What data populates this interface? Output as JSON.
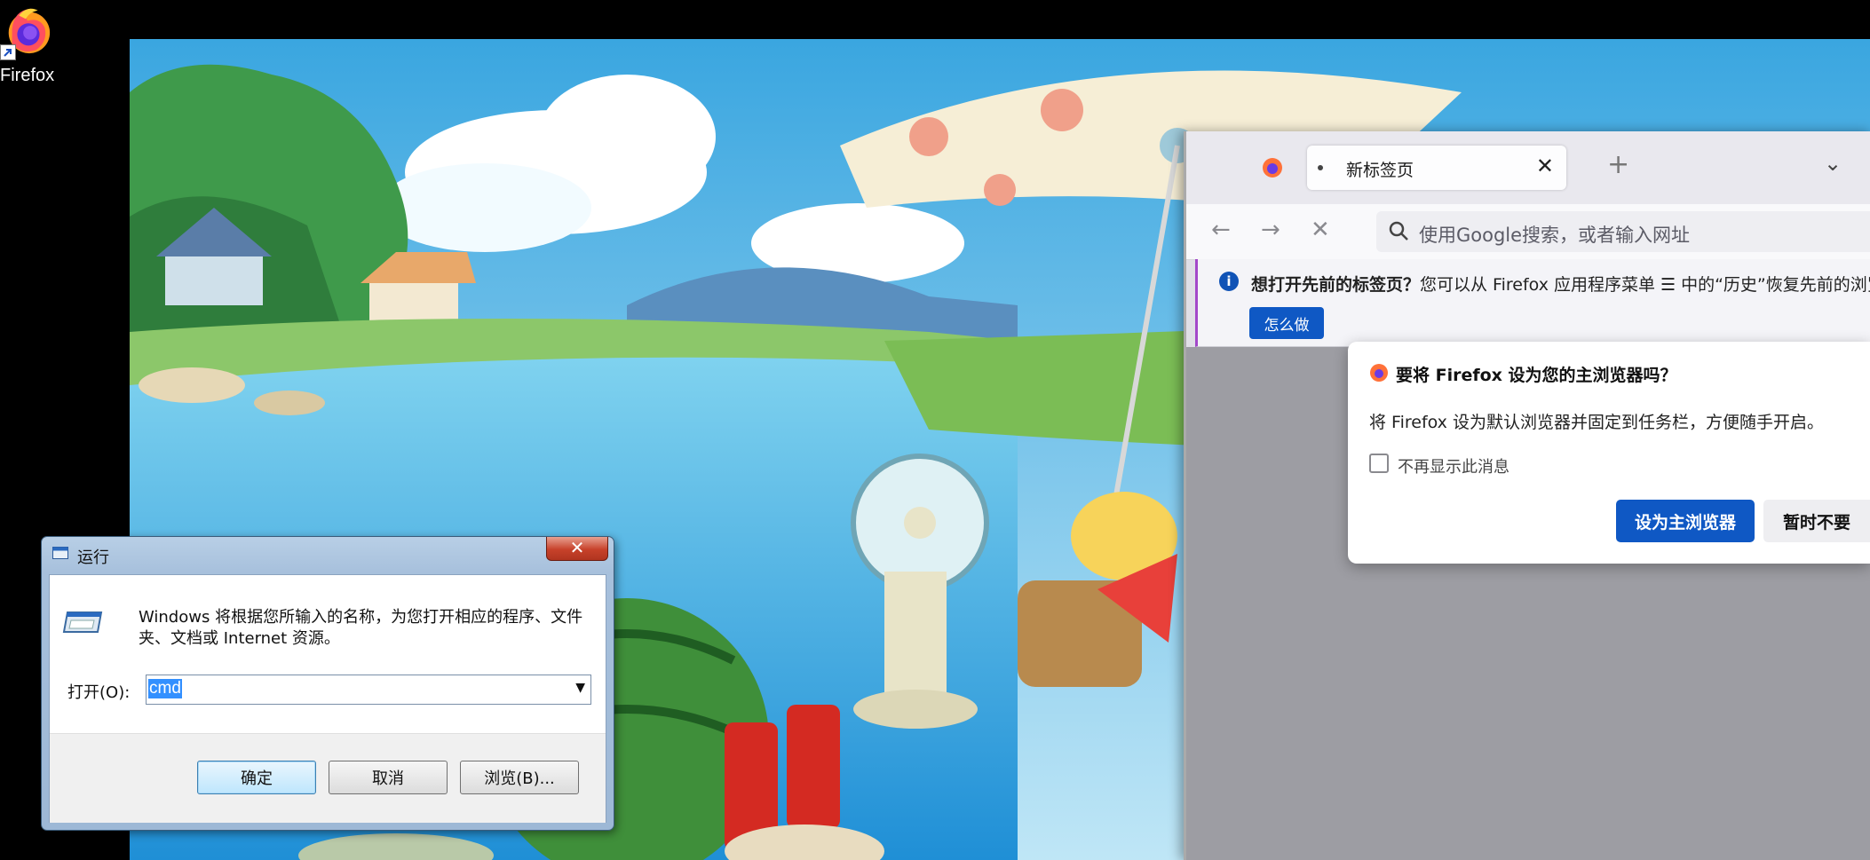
{
  "desktop": {
    "icon_label": "Firefox"
  },
  "browser": {
    "tab_title": "新标签页",
    "tab_close": "✕",
    "new_tab": "+",
    "list_tabs": "⌄",
    "nav": {
      "back": "←",
      "forward": "→",
      "stop": "✕"
    },
    "url_placeholder": "使用Google搜索，或者输入网址",
    "infobar": {
      "bold": "想打开先前的标签页？",
      "text": "您可以从 Firefox 应用程序菜单 ☰ 中的“历史”恢复先前的浏览",
      "button": "怎么做"
    },
    "default_dialog": {
      "title": "要将 Firefox 设为您的主浏览器吗？",
      "body": "将 Firefox 设为默认浏览器并固定到任务栏，方便随手开启。",
      "checkbox_label": "不再显示此消息",
      "primary_button": "设为主浏览器",
      "secondary_button": "暂时不要"
    }
  },
  "run_dialog": {
    "title": "运行",
    "close": "✕",
    "description": "Windows 将根据您所输入的名称，为您打开相应的程序、文件夹、文档或 Internet 资源。",
    "open_label": "打开(O):",
    "input_value": "cmd",
    "ok_button": "确定",
    "cancel_button": "取消",
    "browse_button": "浏览(B)..."
  },
  "colors": {
    "firefox_blue": "#0f58c4",
    "infobar_accent": "#a348c9",
    "win_close_red": "#c7412a",
    "selection": "#3390ff"
  }
}
